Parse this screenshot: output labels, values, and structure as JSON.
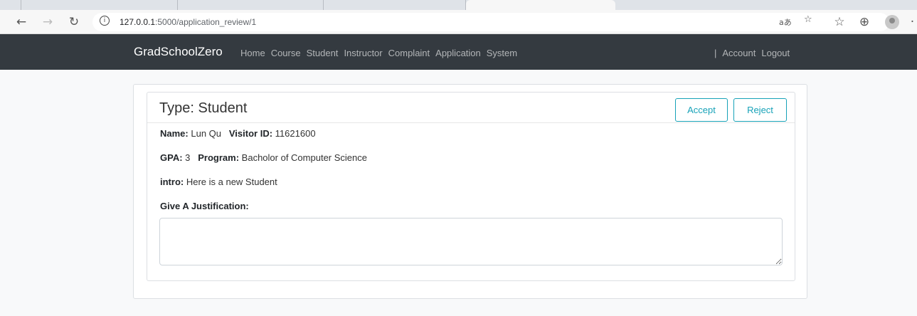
{
  "browser": {
    "url_host": "127.0.0.1",
    "url_path": ":5000/application_review/1",
    "icons": [
      "back-arrow-icon",
      "forward-arrow-icon",
      "reload-icon",
      "info-icon",
      "read-aloud-icon",
      "favorite-icon",
      "favorites-list-icon",
      "collections-icon",
      "profile-icon",
      "more-icon"
    ]
  },
  "navbar": {
    "brand": "GradSchoolZero",
    "links": [
      "Home",
      "Course",
      "Student",
      "Instructor",
      "Complaint",
      "Application",
      "System"
    ],
    "separator": "|",
    "account": "Account",
    "logout": "Logout"
  },
  "application": {
    "title": "Type: Student",
    "accept_label": "Accept",
    "reject_label": "Reject",
    "name_label": "Name:",
    "name_value": "Lun Qu",
    "visitor_label": "Visitor ID:",
    "visitor_value": "11621600",
    "gpa_label": "GPA:",
    "gpa_value": "3",
    "program_label": "Program:",
    "program_value": "Bacholor of Computer Science",
    "intro_label": "intro:",
    "intro_value": "Here is a new Student",
    "justification_label": "Give A Justification:",
    "justification_value": ""
  },
  "colors": {
    "navbar_bg": "#343a40",
    "accent": "#17a2b8"
  }
}
